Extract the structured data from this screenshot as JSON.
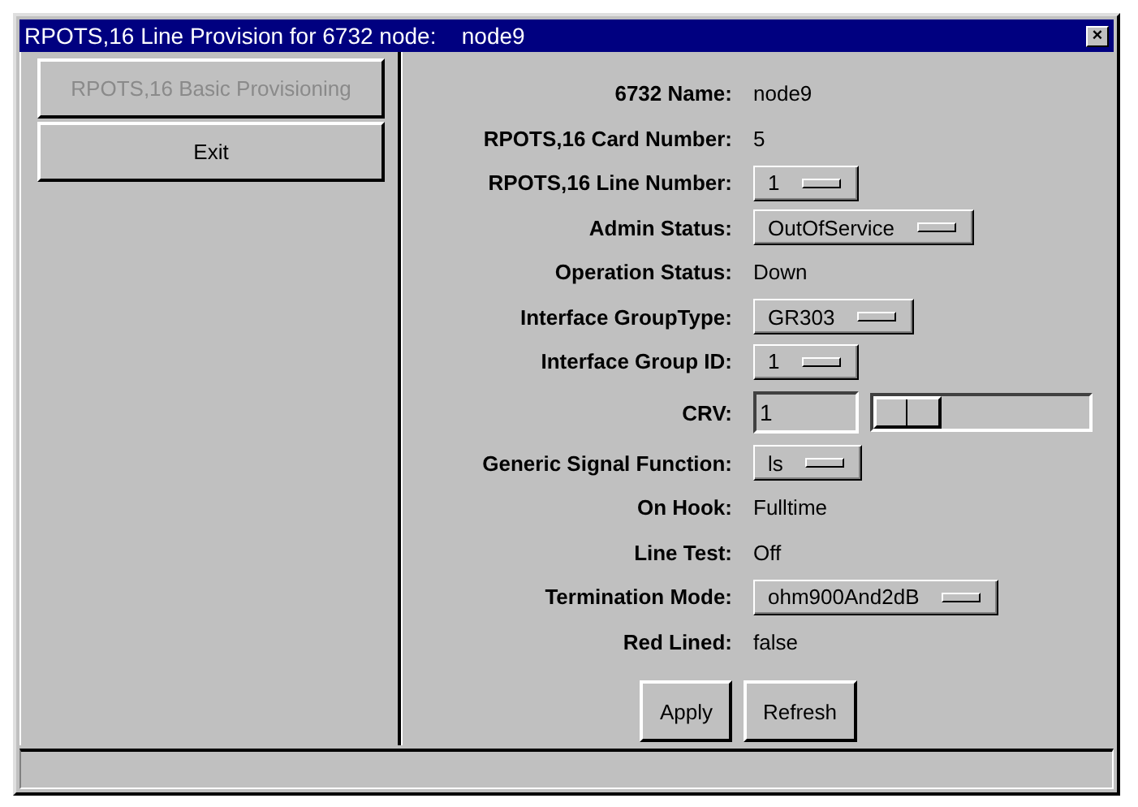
{
  "window": {
    "title": "RPOTS,16 Line Provision for 6732 node:",
    "node": "node9",
    "close": "×"
  },
  "sidebar": {
    "buttons": [
      {
        "label": "RPOTS,16 Basic Provisioning",
        "disabled": true
      },
      {
        "label": "Exit",
        "disabled": false
      }
    ]
  },
  "fields": [
    {
      "kind": "text",
      "label": "6732 Name:",
      "value": "node9"
    },
    {
      "kind": "text",
      "label": "RPOTS,16 Card Number:",
      "value": "5"
    },
    {
      "kind": "dropdown",
      "label": "RPOTS,16 Line Number:",
      "value": "1"
    },
    {
      "kind": "dropdown",
      "label": "Admin Status:",
      "value": "OutOfService"
    },
    {
      "kind": "text",
      "label": "Operation Status:",
      "value": "Down"
    },
    {
      "kind": "dropdown",
      "label": "Interface GroupType:",
      "value": "GR303"
    },
    {
      "kind": "dropdown",
      "label": "Interface Group ID:",
      "value": "1"
    },
    {
      "kind": "input_slider",
      "label": "CRV:",
      "value": "1",
      "level": 0
    },
    {
      "kind": "dropdown",
      "label": "Generic Signal Function:",
      "value": "ls"
    },
    {
      "kind": "text",
      "label": "On Hook:",
      "value": "Fulltime"
    },
    {
      "kind": "text",
      "label": "Line Test:",
      "value": "Off"
    },
    {
      "kind": "dropdown",
      "label": "Termination Mode:",
      "value": "ohm900And2dB"
    },
    {
      "kind": "text",
      "label": "Red Lined:",
      "value": "false"
    }
  ],
  "buttons": [
    "Apply",
    "Refresh"
  ]
}
